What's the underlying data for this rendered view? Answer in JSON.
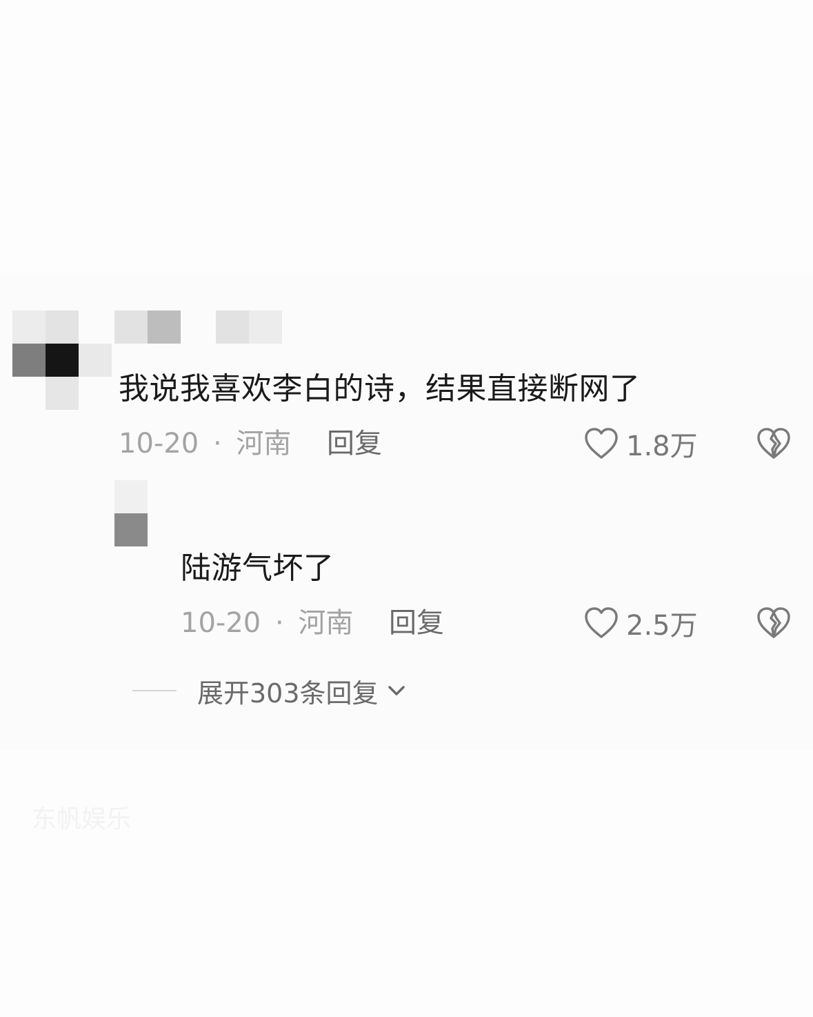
{
  "comment": {
    "text": "我说我喜欢李白的诗，结果直接断网了",
    "date": "10-20",
    "separator": "·",
    "location": "河南",
    "reply_label": "回复",
    "likes": "1.8万"
  },
  "reply": {
    "text": "陆游气坏了",
    "date": "10-20",
    "separator": "·",
    "location": "河南",
    "reply_label": "回复",
    "likes": "2.5万"
  },
  "expand": {
    "label": "展开303条回复"
  },
  "watermark": {
    "text": "东帆娱乐"
  },
  "colors": {
    "text": "#1a1a1a",
    "meta": "#a3a3a3",
    "action": "#6a6a6a"
  },
  "icons": {
    "like": "heart-outline-icon",
    "dislike": "broken-heart-icon",
    "expand": "chevron-down-icon"
  }
}
